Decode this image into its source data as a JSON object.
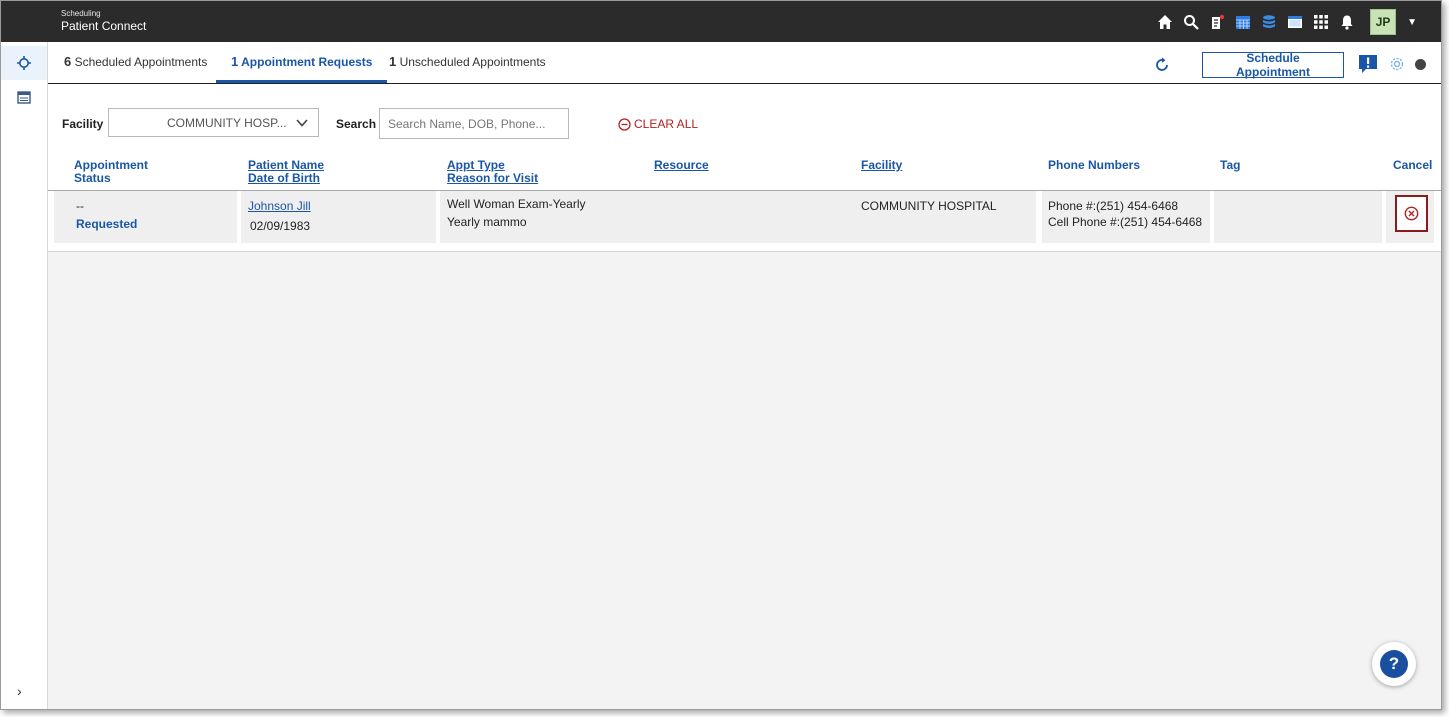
{
  "app": {
    "subtitle": "Scheduling",
    "title": "Patient Connect",
    "user_initials": "JP"
  },
  "tabs": [
    {
      "count": "6",
      "label": "Scheduled Appointments",
      "active": false
    },
    {
      "count": "1",
      "label": "Appointment Requests",
      "active": true
    },
    {
      "count": "1",
      "label": "Unscheduled Appointments",
      "active": false
    }
  ],
  "toolbar": {
    "schedule_label": "Schedule Appointment"
  },
  "filters": {
    "facility_label": "Facility",
    "facility_value": "COMMUNITY HOSP...",
    "search_label": "Search",
    "search_placeholder": "Search Name, DOB, Phone...",
    "clear_all": "CLEAR ALL"
  },
  "columns": {
    "status_1": "Appointment",
    "status_2": "Status",
    "patient_1": "Patient Name",
    "patient_2": "Date of Birth",
    "appt_1": "Appt Type",
    "appt_2": "Reason for Visit",
    "resource": "Resource",
    "facility": "Facility",
    "phones": "Phone Numbers",
    "tag": "Tag",
    "cancel": "Cancel"
  },
  "rows": [
    {
      "status_top": "--",
      "status": "Requested",
      "patient_name": "Johnson Jill",
      "dob": "02/09/1983",
      "appt_type": "Well Woman Exam-Yearly",
      "reason": "Yearly mammo",
      "resource": "",
      "facility": "COMMUNITY HOSPITAL",
      "phone": "Phone #:(251) 454-6468",
      "cell_phone": "Cell Phone #:(251) 454-6468",
      "tag": ""
    }
  ],
  "colors": {
    "accent": "#1a56a6",
    "topbar": "#2b2b2b",
    "cancel_border": "#8b1a1a",
    "clear_all": "#b22222"
  },
  "icons": {
    "top": [
      "home-icon",
      "search-icon",
      "clipboard-icon",
      "calendar-grid-icon",
      "stack-icon",
      "window-icon",
      "apps-grid-icon",
      "bell-icon"
    ],
    "rail": [
      "crosshair-icon",
      "calendar-icon"
    ],
    "help": "?"
  }
}
